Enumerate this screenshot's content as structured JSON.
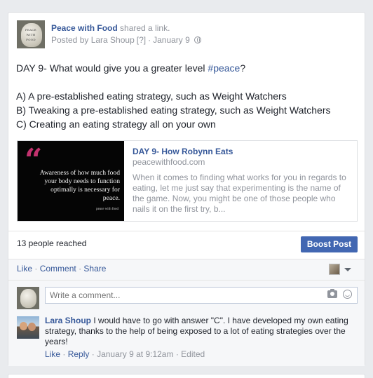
{
  "post": {
    "page_name": "Peace with Food",
    "shared_text": "shared a link.",
    "posted_by_text": "Posted by Lara Shoup",
    "help_marker": "[?]",
    "sep": "·",
    "date": "January 9",
    "privacy_icon": "globe-icon",
    "avatar_text": [
      "PEACE",
      "WITH",
      "FOOD"
    ],
    "text_line1_prefix": "DAY 9- What would give you a greater level ",
    "hashtag": "#peace",
    "text_line1_suffix": "?",
    "options": [
      "A) A pre-established eating strategy, such as Weight Watchers",
      "B) Tweaking a pre-established eating strategy, such as Weight Watchers",
      "C) Creating an eating strategy all on your own"
    ]
  },
  "link_preview": {
    "title": "DAY 9- How Robynn Eats",
    "domain": "peacewithfood.com",
    "description": "When it comes to finding what works for you in regards to eating, let me just say that experimenting is the name of the game. Now, you might be one of those people who nails it on the first try, b...",
    "thumb_quote_mark": "“",
    "thumb_quote": "Awareness of how much food your body needs to function optimally is necessary for peace.",
    "thumb_credit": "peace with food"
  },
  "stats": {
    "reach": "13 people reached",
    "boost_label": "Boost Post"
  },
  "actions": {
    "like": "Like",
    "comment": "Comment",
    "share": "Share",
    "sep": "·"
  },
  "composer": {
    "placeholder": "Write a comment..."
  },
  "comment": {
    "author": "Lara Shoup",
    "text": "I would have to go with answer \"C\". I have developed my own eating strategy, thanks to the help of being exposed to a lot of eating strategies over the years!",
    "like": "Like",
    "reply": "Reply",
    "time": "January 9 at 9:12am",
    "edited": "Edited",
    "sep": "·"
  },
  "colors": {
    "link_blue": "#365899",
    "boost_blue": "#4267b2",
    "muted_gray": "#90949c",
    "quote_pink": "#c2326e"
  }
}
